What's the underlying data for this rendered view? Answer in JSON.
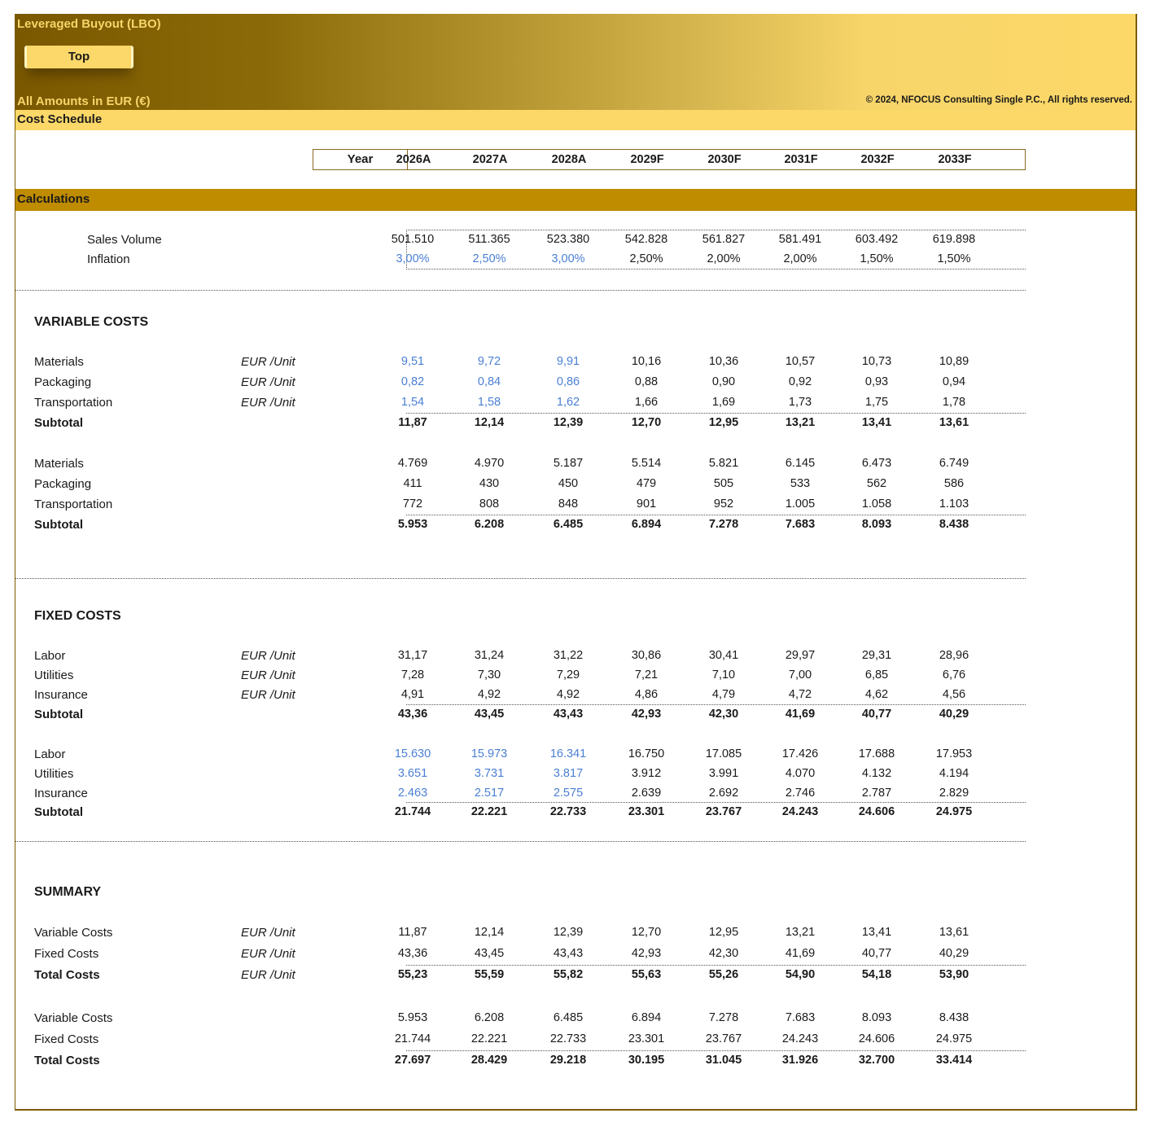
{
  "banner": {
    "title": "Leveraged Buyout (LBO)",
    "top_button": "Top",
    "amounts_note": "All Amounts in  EUR (€)",
    "copyright": "© 2024, NFOCUS Consulting Single P.C., All rights reserved."
  },
  "sheet_title": "Cost Schedule",
  "year_header": {
    "label": "Year",
    "years": [
      "2026A",
      "2027A",
      "2028A",
      "2029F",
      "2030F",
      "2031F",
      "2032F",
      "2033F"
    ]
  },
  "calculations": {
    "title": "Calculations",
    "sales_volume": {
      "label": "Sales Volume",
      "values": [
        "501.510",
        "511.365",
        "523.380",
        "542.828",
        "561.827",
        "581.491",
        "603.492",
        "619.898"
      ]
    },
    "inflation": {
      "label": "Inflation",
      "values": [
        "3,00%",
        "2,50%",
        "3,00%",
        "2,50%",
        "2,00%",
        "2,00%",
        "1,50%",
        "1,50%"
      ],
      "input_columns": 3
    }
  },
  "variable_costs": {
    "title": "VARIABLE COSTS",
    "per_unit": {
      "rows": [
        {
          "label": "Materials",
          "unit": "EUR /Unit",
          "values": [
            "9,51",
            "9,72",
            "9,91",
            "10,16",
            "10,36",
            "10,57",
            "10,73",
            "10,89"
          ],
          "input_columns": 3
        },
        {
          "label": "Packaging",
          "unit": "EUR /Unit",
          "values": [
            "0,82",
            "0,84",
            "0,86",
            "0,88",
            "0,90",
            "0,92",
            "0,93",
            "0,94"
          ],
          "input_columns": 3
        },
        {
          "label": "Transportation",
          "unit": "EUR /Unit",
          "values": [
            "1,54",
            "1,58",
            "1,62",
            "1,66",
            "1,69",
            "1,73",
            "1,75",
            "1,78"
          ],
          "input_columns": 3
        }
      ],
      "subtotal": {
        "label": "Subtotal",
        "values": [
          "11,87",
          "12,14",
          "12,39",
          "12,70",
          "12,95",
          "13,21",
          "13,41",
          "13,61"
        ]
      }
    },
    "totals": {
      "rows": [
        {
          "label": "Materials",
          "values": [
            "4.769",
            "4.970",
            "5.187",
            "5.514",
            "5.821",
            "6.145",
            "6.473",
            "6.749"
          ]
        },
        {
          "label": "Packaging",
          "values": [
            "411",
            "430",
            "450",
            "479",
            "505",
            "533",
            "562",
            "586"
          ]
        },
        {
          "label": "Transportation",
          "values": [
            "772",
            "808",
            "848",
            "901",
            "952",
            "1.005",
            "1.058",
            "1.103"
          ]
        }
      ],
      "subtotal": {
        "label": "Subtotal",
        "values": [
          "5.953",
          "6.208",
          "6.485",
          "6.894",
          "7.278",
          "7.683",
          "8.093",
          "8.438"
        ]
      }
    }
  },
  "fixed_costs": {
    "title": "FIXED COSTS",
    "per_unit": {
      "rows": [
        {
          "label": "Labor",
          "unit": "EUR /Unit",
          "values": [
            "31,17",
            "31,24",
            "31,22",
            "30,86",
            "30,41",
            "29,97",
            "29,31",
            "28,96"
          ]
        },
        {
          "label": "Utilities",
          "unit": "EUR /Unit",
          "values": [
            "7,28",
            "7,30",
            "7,29",
            "7,21",
            "7,10",
            "7,00",
            "6,85",
            "6,76"
          ]
        },
        {
          "label": "Insurance",
          "unit": "EUR /Unit",
          "values": [
            "4,91",
            "4,92",
            "4,92",
            "4,86",
            "4,79",
            "4,72",
            "4,62",
            "4,56"
          ]
        }
      ],
      "subtotal": {
        "label": "Subtotal",
        "values": [
          "43,36",
          "43,45",
          "43,43",
          "42,93",
          "42,30",
          "41,69",
          "40,77",
          "40,29"
        ]
      }
    },
    "totals": {
      "rows": [
        {
          "label": "Labor",
          "values": [
            "15.630",
            "15.973",
            "16.341",
            "16.750",
            "17.085",
            "17.426",
            "17.688",
            "17.953"
          ],
          "input_columns": 3
        },
        {
          "label": "Utilities",
          "values": [
            "3.651",
            "3.731",
            "3.817",
            "3.912",
            "3.991",
            "4.070",
            "4.132",
            "4.194"
          ],
          "input_columns": 3
        },
        {
          "label": "Insurance",
          "values": [
            "2.463",
            "2.517",
            "2.575",
            "2.639",
            "2.692",
            "2.746",
            "2.787",
            "2.829"
          ],
          "input_columns": 3
        }
      ],
      "subtotal": {
        "label": "Subtotal",
        "values": [
          "21.744",
          "22.221",
          "22.733",
          "23.301",
          "23.767",
          "24.243",
          "24.606",
          "24.975"
        ]
      }
    }
  },
  "summary": {
    "title": "SUMMARY",
    "per_unit": {
      "rows": [
        {
          "label": "Variable Costs",
          "unit": "EUR /Unit",
          "values": [
            "11,87",
            "12,14",
            "12,39",
            "12,70",
            "12,95",
            "13,21",
            "13,41",
            "13,61"
          ]
        },
        {
          "label": "Fixed Costs",
          "unit": "EUR /Unit",
          "values": [
            "43,36",
            "43,45",
            "43,43",
            "42,93",
            "42,30",
            "41,69",
            "40,77",
            "40,29"
          ]
        }
      ],
      "total": {
        "label": "Total Costs",
        "unit": "EUR /Unit",
        "values": [
          "55,23",
          "55,59",
          "55,82",
          "55,63",
          "55,26",
          "54,90",
          "54,18",
          "53,90"
        ]
      }
    },
    "totals": {
      "rows": [
        {
          "label": "Variable Costs",
          "values": [
            "5.953",
            "6.208",
            "6.485",
            "6.894",
            "7.278",
            "7.683",
            "8.093",
            "8.438"
          ]
        },
        {
          "label": "Fixed Costs",
          "values": [
            "21.744",
            "22.221",
            "22.733",
            "23.301",
            "23.767",
            "24.243",
            "24.606",
            "24.975"
          ]
        }
      ],
      "total": {
        "label": "Total Costs",
        "values": [
          "27.697",
          "28.429",
          "29.218",
          "30.195",
          "31.045",
          "31.926",
          "32.700",
          "33.414"
        ]
      }
    }
  },
  "colors": {
    "banner_dark": "#7a5800",
    "banner_light": "#fcd868",
    "calc_bar": "#bf8c00",
    "input_blue": "#4a7fd4"
  }
}
